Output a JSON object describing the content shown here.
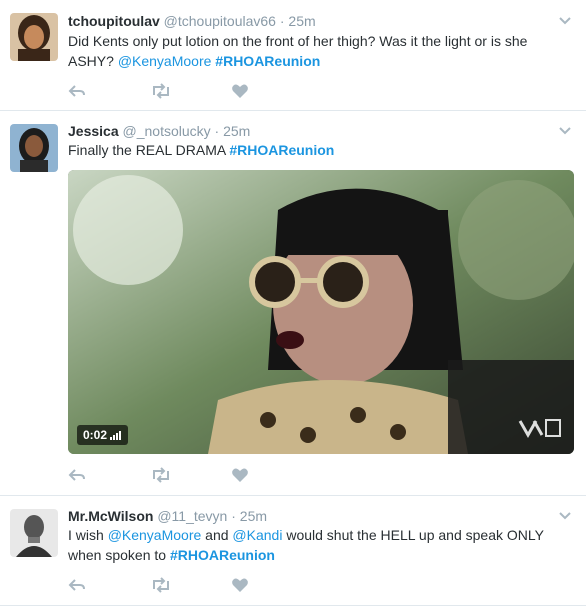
{
  "tweets": [
    {
      "name": "tchoupitoulav",
      "handle": "@tchoupitoulav66",
      "time": "25m",
      "text_parts": [
        "Did Kents only put lotion on the front of her thigh? Was it the light or is she ASHY? ",
        "@KenyaMoore",
        " ",
        "#RHOAReunion"
      ]
    },
    {
      "name": "Jessica",
      "handle": "@_notsolucky",
      "time": "25m",
      "text_parts": [
        "Finally the REAL DRAMA ",
        "#RHOAReunion"
      ],
      "media": {
        "duration": "0:02"
      }
    },
    {
      "name": "Mr.McWilson",
      "handle": "@11_tevyn",
      "time": "25m",
      "text_parts": [
        "I wish ",
        "@KenyaMoore",
        " and ",
        "@Kandi",
        " would shut the HELL up and speak ONLY when spoken to ",
        "#RHOAReunion"
      ]
    }
  ],
  "separator": "·",
  "colors": {
    "link": "#1b95e0",
    "muted": "#8899a6",
    "text": "#292f33",
    "divider": "#e1e8ed"
  },
  "icons": [
    "reply-icon",
    "retweet-icon",
    "like-icon",
    "caret-down-icon",
    "volume-icon"
  ]
}
